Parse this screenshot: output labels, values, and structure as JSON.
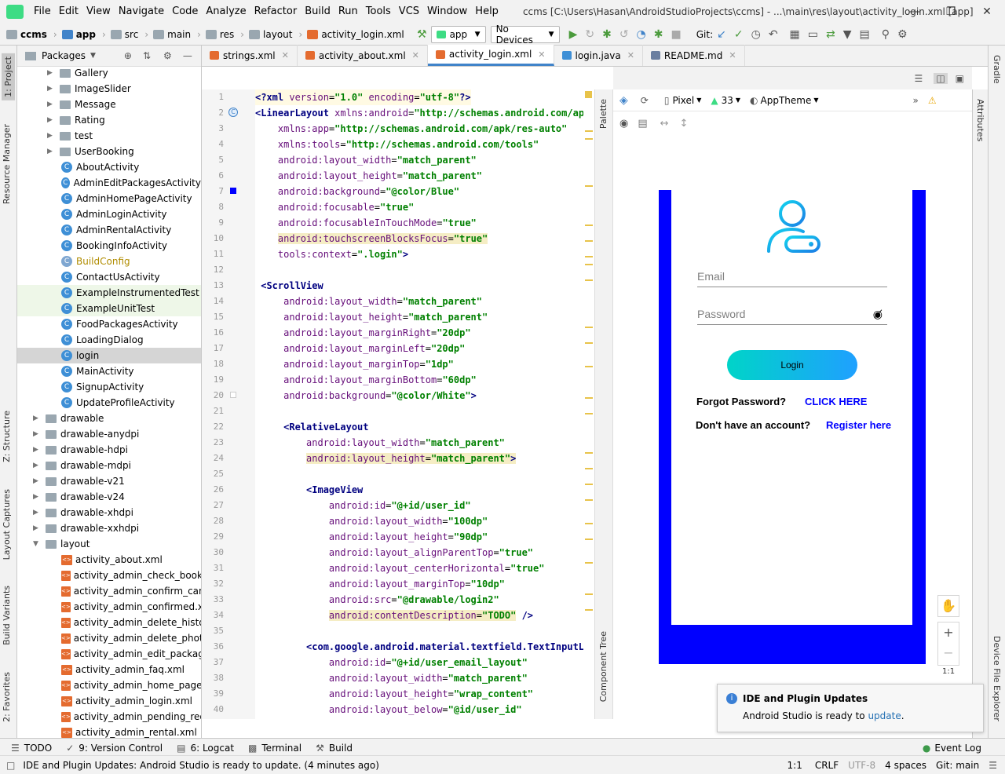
{
  "menubar": {
    "items": [
      "File",
      "Edit",
      "View",
      "Navigate",
      "Code",
      "Analyze",
      "Refactor",
      "Build",
      "Run",
      "Tools",
      "VCS",
      "Window",
      "Help"
    ],
    "window_title": "ccms [C:\\Users\\Hasan\\AndroidStudioProjects\\ccms] - ...\\main\\res\\layout\\activity_login.xml [app]"
  },
  "breadcrumb": [
    "ccms",
    "app",
    "src",
    "main",
    "res",
    "layout",
    "activity_login.xml"
  ],
  "toolbar": {
    "run_config": "app",
    "device": "No Devices",
    "git_label": "Git:"
  },
  "left_strip": {
    "tabs": [
      "1: Project",
      "Resource Manager",
      "Z: Structure",
      "Layout Captures",
      "Build Variants",
      "2: Favorites"
    ]
  },
  "project_panel": {
    "view_label": "Packages",
    "items": [
      {
        "label": "Gallery",
        "kind": "folder",
        "indent": 1
      },
      {
        "label": "ImageSlider",
        "kind": "folder",
        "indent": 1
      },
      {
        "label": "Message",
        "kind": "folder",
        "indent": 1
      },
      {
        "label": "Rating",
        "kind": "folder",
        "indent": 1
      },
      {
        "label": "test",
        "kind": "folder",
        "indent": 1
      },
      {
        "label": "UserBooking",
        "kind": "folder",
        "indent": 1
      },
      {
        "label": "AboutActivity",
        "kind": "class",
        "indent": 2
      },
      {
        "label": "AdminEditPackagesActivity",
        "kind": "class",
        "indent": 2
      },
      {
        "label": "AdminHomePageActivity",
        "kind": "class",
        "indent": 2
      },
      {
        "label": "AdminLoginActivity",
        "kind": "class",
        "indent": 2
      },
      {
        "label": "AdminRentalActivity",
        "kind": "class",
        "indent": 2
      },
      {
        "label": "BookingInfoActivity",
        "kind": "class",
        "indent": 2
      },
      {
        "label": "BuildConfig",
        "kind": "class-gen",
        "indent": 2
      },
      {
        "label": "ContactUsActivity",
        "kind": "class",
        "indent": 2
      },
      {
        "label": "ExampleInstrumentedTest",
        "kind": "class-test",
        "indent": 2
      },
      {
        "label": "ExampleUnitTest",
        "kind": "class-test",
        "indent": 2
      },
      {
        "label": "FoodPackagesActivity",
        "kind": "class",
        "indent": 2
      },
      {
        "label": "LoadingDialog",
        "kind": "class",
        "indent": 2
      },
      {
        "label": "login",
        "kind": "class-selected",
        "indent": 2
      },
      {
        "label": "MainActivity",
        "kind": "class",
        "indent": 2
      },
      {
        "label": "SignupActivity",
        "kind": "class",
        "indent": 2
      },
      {
        "label": "UpdateProfileActivity",
        "kind": "class",
        "indent": 2
      },
      {
        "label": "drawable",
        "kind": "folder",
        "indent": 0
      },
      {
        "label": "drawable-anydpi",
        "kind": "folder",
        "indent": 0
      },
      {
        "label": "drawable-hdpi",
        "kind": "folder",
        "indent": 0
      },
      {
        "label": "drawable-mdpi",
        "kind": "folder",
        "indent": 0
      },
      {
        "label": "drawable-v21",
        "kind": "folder",
        "indent": 0
      },
      {
        "label": "drawable-v24",
        "kind": "folder",
        "indent": 0
      },
      {
        "label": "drawable-xhdpi",
        "kind": "folder",
        "indent": 0
      },
      {
        "label": "drawable-xxhdpi",
        "kind": "folder",
        "indent": 0
      },
      {
        "label": "layout",
        "kind": "folder-open",
        "indent": 0
      },
      {
        "label": "activity_about.xml",
        "kind": "xml",
        "indent": 2
      },
      {
        "label": "activity_admin_check_booking",
        "kind": "xml",
        "indent": 2
      },
      {
        "label": "activity_admin_confirm_cance",
        "kind": "xml",
        "indent": 2
      },
      {
        "label": "activity_admin_confirmed.xml",
        "kind": "xml",
        "indent": 2
      },
      {
        "label": "activity_admin_delete_history.",
        "kind": "xml",
        "indent": 2
      },
      {
        "label": "activity_admin_delete_photo.x",
        "kind": "xml",
        "indent": 2
      },
      {
        "label": "activity_admin_edit_packages.",
        "kind": "xml",
        "indent": 2
      },
      {
        "label": "activity_admin_faq.xml",
        "kind": "xml",
        "indent": 2
      },
      {
        "label": "activity_admin_home_page.xn",
        "kind": "xml",
        "indent": 2
      },
      {
        "label": "activity_admin_login.xml",
        "kind": "xml",
        "indent": 2
      },
      {
        "label": "activity_admin_pending_reque",
        "kind": "xml",
        "indent": 2
      },
      {
        "label": "activity_admin_rental.xml",
        "kind": "xml",
        "indent": 2
      }
    ]
  },
  "editor_tabs": [
    {
      "label": "strings.xml",
      "active": false
    },
    {
      "label": "activity_about.xml",
      "active": false
    },
    {
      "label": "activity_login.xml",
      "active": true
    },
    {
      "label": "login.java",
      "active": false
    },
    {
      "label": "README.md",
      "active": false
    }
  ],
  "code_lines": [
    [
      [
        "tg",
        "<?xml "
      ],
      [
        "at",
        "version"
      ],
      [
        "",
        "="
      ],
      [
        "vl",
        "\"1.0\""
      ],
      [
        "at",
        " encoding"
      ],
      [
        "",
        "="
      ],
      [
        "vl",
        "\"utf-8\""
      ],
      [
        "tg",
        "?>"
      ]
    ],
    [
      [
        "tg",
        "<LinearLayout "
      ],
      [
        "at",
        "xmlns:android"
      ],
      [
        "",
        "="
      ],
      [
        "vl",
        "\"http://schemas.android.com/apk/re"
      ]
    ],
    [
      [
        "",
        "    "
      ],
      [
        "at",
        "xmlns:app"
      ],
      [
        "",
        "="
      ],
      [
        "vl",
        "\"http://schemas.android.com/apk/res-auto\""
      ]
    ],
    [
      [
        "",
        "    "
      ],
      [
        "at",
        "xmlns:tools"
      ],
      [
        "",
        "="
      ],
      [
        "vl",
        "\"http://schemas.android.com/tools\""
      ]
    ],
    [
      [
        "",
        "    "
      ],
      [
        "at",
        "android:layout_width"
      ],
      [
        "",
        "="
      ],
      [
        "vl",
        "\"match_parent\""
      ]
    ],
    [
      [
        "",
        "    "
      ],
      [
        "at",
        "android:layout_height"
      ],
      [
        "",
        "="
      ],
      [
        "vl",
        "\"match_parent\""
      ]
    ],
    [
      [
        "",
        "    "
      ],
      [
        "at",
        "android:background"
      ],
      [
        "",
        "="
      ],
      [
        "vl",
        "\"@color/Blue\""
      ]
    ],
    [
      [
        "",
        "    "
      ],
      [
        "at",
        "android:focusable"
      ],
      [
        "",
        "="
      ],
      [
        "vl",
        "\"true\""
      ]
    ],
    [
      [
        "",
        "    "
      ],
      [
        "at",
        "android:focusableInTouchMode"
      ],
      [
        "",
        "="
      ],
      [
        "vl",
        "\"true\""
      ]
    ],
    [
      [
        "",
        "    "
      ],
      [
        "hl:at",
        "android:touchscreenBlocksFocus"
      ],
      [
        "hl",
        "="
      ],
      [
        "hl:vl",
        "\"true\""
      ]
    ],
    [
      [
        "",
        "    "
      ],
      [
        "at",
        "tools:context"
      ],
      [
        "",
        "="
      ],
      [
        "vl",
        "\".login\""
      ],
      [
        "tg",
        ">"
      ]
    ],
    [
      [
        "",
        ""
      ]
    ],
    [
      [
        "tg",
        " <ScrollView"
      ]
    ],
    [
      [
        "",
        "     "
      ],
      [
        "at",
        "android:layout_width"
      ],
      [
        "",
        "="
      ],
      [
        "vl",
        "\"match_parent\""
      ]
    ],
    [
      [
        "",
        "     "
      ],
      [
        "at",
        "android:layout_height"
      ],
      [
        "",
        "="
      ],
      [
        "vl",
        "\"match_parent\""
      ]
    ],
    [
      [
        "",
        "     "
      ],
      [
        "at",
        "android:layout_marginRight"
      ],
      [
        "",
        "="
      ],
      [
        "vl",
        "\"20dp\""
      ]
    ],
    [
      [
        "",
        "     "
      ],
      [
        "at",
        "android:layout_marginLeft"
      ],
      [
        "",
        "="
      ],
      [
        "vl",
        "\"20dp\""
      ]
    ],
    [
      [
        "",
        "     "
      ],
      [
        "at",
        "android:layout_marginTop"
      ],
      [
        "",
        "="
      ],
      [
        "vl",
        "\"1dp\""
      ]
    ],
    [
      [
        "",
        "     "
      ],
      [
        "at",
        "android:layout_marginBottom"
      ],
      [
        "",
        "="
      ],
      [
        "vl",
        "\"60dp\""
      ]
    ],
    [
      [
        "",
        "     "
      ],
      [
        "at",
        "android:background"
      ],
      [
        "",
        "="
      ],
      [
        "vl",
        "\"@color/White\""
      ],
      [
        "tg",
        ">"
      ]
    ],
    [
      [
        "",
        ""
      ]
    ],
    [
      [
        "tg",
        "     <RelativeLayout"
      ]
    ],
    [
      [
        "",
        "         "
      ],
      [
        "at",
        "android:layout_width"
      ],
      [
        "",
        "="
      ],
      [
        "vl",
        "\"match_parent\""
      ]
    ],
    [
      [
        "",
        "         "
      ],
      [
        "hl:at",
        "android:layout_height"
      ],
      [
        "hl",
        "="
      ],
      [
        "hl:vl",
        "\"match_parent\""
      ],
      [
        "hl:tg",
        ">"
      ]
    ],
    [
      [
        "",
        ""
      ]
    ],
    [
      [
        "tg",
        "         <ImageView"
      ]
    ],
    [
      [
        "",
        "             "
      ],
      [
        "at",
        "android:id"
      ],
      [
        "",
        "="
      ],
      [
        "vl",
        "\"@+id/user_id\""
      ]
    ],
    [
      [
        "",
        "             "
      ],
      [
        "at",
        "android:layout_width"
      ],
      [
        "",
        "="
      ],
      [
        "vl",
        "\"100dp\""
      ]
    ],
    [
      [
        "",
        "             "
      ],
      [
        "at",
        "android:layout_height"
      ],
      [
        "",
        "="
      ],
      [
        "vl",
        "\"90dp\""
      ]
    ],
    [
      [
        "",
        "             "
      ],
      [
        "at",
        "android:layout_alignParentTop"
      ],
      [
        "",
        "="
      ],
      [
        "vl",
        "\"true\""
      ]
    ],
    [
      [
        "",
        "             "
      ],
      [
        "at",
        "android:layout_centerHorizontal"
      ],
      [
        "",
        "="
      ],
      [
        "vl",
        "\"true\""
      ]
    ],
    [
      [
        "",
        "             "
      ],
      [
        "at",
        "android:layout_marginTop"
      ],
      [
        "",
        "="
      ],
      [
        "vl",
        "\"10dp\""
      ]
    ],
    [
      [
        "",
        "             "
      ],
      [
        "at",
        "android:src"
      ],
      [
        "",
        "="
      ],
      [
        "vl",
        "\"@drawable/login2\""
      ]
    ],
    [
      [
        "",
        "             "
      ],
      [
        "hl:at",
        "android:contentDescription"
      ],
      [
        "hl",
        "="
      ],
      [
        "hl:vl",
        "\"TODO\""
      ],
      [
        "tg",
        " />"
      ]
    ],
    [
      [
        "",
        ""
      ]
    ],
    [
      [
        "tg",
        "         <com.google.android.material.textfield.TextInputLayou"
      ]
    ],
    [
      [
        "",
        "             "
      ],
      [
        "at",
        "android:id"
      ],
      [
        "",
        "="
      ],
      [
        "vl",
        "\"@+id/user_email_layout\""
      ]
    ],
    [
      [
        "",
        "             "
      ],
      [
        "at",
        "android:layout_width"
      ],
      [
        "",
        "="
      ],
      [
        "vl",
        "\"match_parent\""
      ]
    ],
    [
      [
        "",
        "             "
      ],
      [
        "at",
        "android:layout_height"
      ],
      [
        "",
        "="
      ],
      [
        "vl",
        "\"wrap_content\""
      ]
    ],
    [
      [
        "",
        "             "
      ],
      [
        "at",
        "android:layout_below"
      ],
      [
        "",
        "="
      ],
      [
        "vl",
        "\"@id/user_id\""
      ]
    ]
  ],
  "design": {
    "device": "Pixel",
    "api": "33",
    "theme": "AppTheme",
    "palette_label": "Palette",
    "component_tree_label": "Component Tree",
    "attributes_label": "Attributes",
    "gradle_label": "Gradle",
    "device_explorer_label": "Device File Explorer",
    "zoom_ratio": "1:1",
    "phone_bg": "#0000ff"
  },
  "preview": {
    "email_hint": "Email",
    "password_hint": "Password",
    "login_button": "Login",
    "forgot_label": "Forgot Password?",
    "forgot_link": "CLICK HERE",
    "account_label": "Don't have an account?",
    "register_link": "Register here"
  },
  "notification": {
    "title": "IDE and Plugin Updates",
    "body_prefix": "Android Studio is ready to ",
    "body_link": "update",
    "body_suffix": "."
  },
  "bottom_tabs": [
    "TODO",
    "9: Version Control",
    "6: Logcat",
    "Terminal",
    "Build"
  ],
  "event_log": "Event Log",
  "status": {
    "message": "IDE and Plugin Updates: Android Studio is ready to update. (4 minutes ago)",
    "position": "1:1",
    "line_sep": "CRLF",
    "encoding": "UTF-8",
    "indent": "4 spaces",
    "git": "Git: main"
  }
}
